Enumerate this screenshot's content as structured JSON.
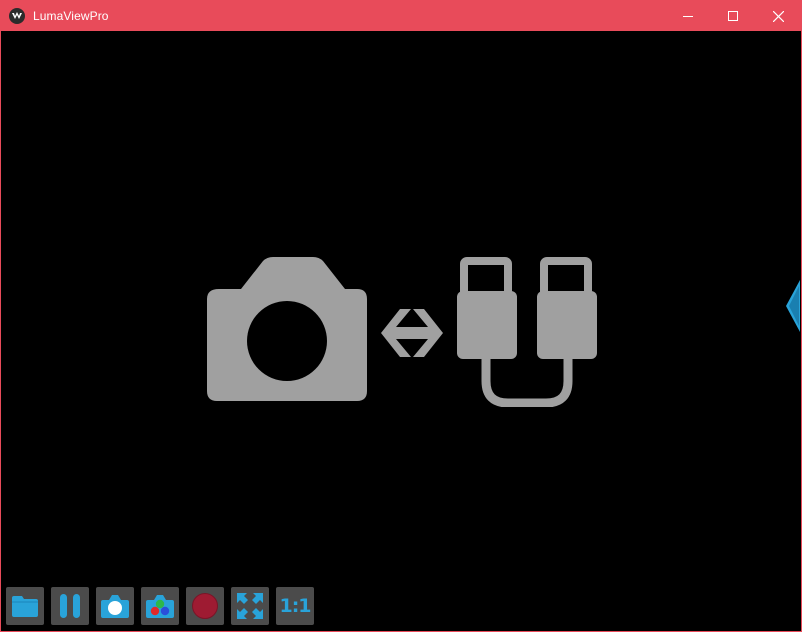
{
  "window": {
    "title": "LumaViewPro",
    "controls": [
      "minimize-icon",
      "maximize-icon",
      "close-icon"
    ]
  },
  "viewport": {
    "status_graphic": [
      "camera-icon",
      "double-arrow-icon",
      "usb-cable-icon"
    ]
  },
  "toolbar": {
    "buttons": [
      {
        "icon": "folder-icon"
      },
      {
        "icon": "pause-icon"
      },
      {
        "icon": "camera-capture-icon"
      },
      {
        "icon": "composite-channels-icon"
      },
      {
        "icon": "record-icon"
      },
      {
        "icon": "fit-screen-icon"
      },
      {
        "icon": "one-to-one-icon",
        "label": "1:1"
      }
    ]
  },
  "colors": {
    "titlebar": "#e84b5a",
    "accent": "#29a3d9",
    "graphic": "#a0a0a0",
    "record": "#9e1b32",
    "button_bg": "#4b4b4b"
  }
}
